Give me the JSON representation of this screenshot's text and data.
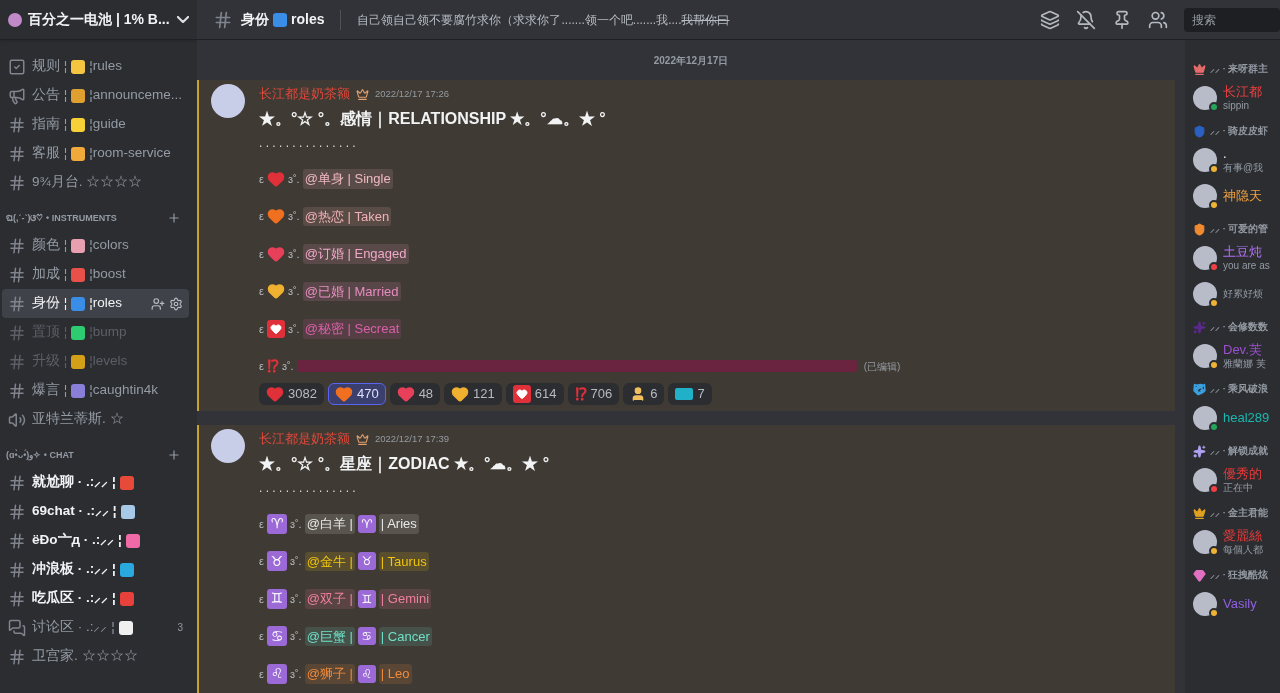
{
  "server": {
    "name": "百分之一电池 | 1% B..."
  },
  "sidebar": {
    "items": [
      {
        "kind": "rules",
        "name": "规则 ¦",
        "color": "#f5c542",
        "slug": "¦rules",
        "muted": false,
        "unread": false,
        "selected": false
      },
      {
        "kind": "announcement",
        "name": "公告 ¦",
        "color": "#e0a030",
        "slug": "¦announceme...",
        "muted": false,
        "unread": false,
        "selected": false
      },
      {
        "kind": "text",
        "name": "指南 ¦",
        "color": "#f7d038",
        "slug": "¦guide",
        "muted": false,
        "unread": false,
        "selected": false
      },
      {
        "kind": "text",
        "name": "客服 ¦",
        "color": "#f0a93a",
        "slug": "¦room-service",
        "muted": false,
        "unread": false,
        "selected": false
      },
      {
        "kind": "text",
        "name": "9¾月台. ☆☆☆☆",
        "muted": false,
        "unread": false,
        "selected": false
      },
      {
        "kind": "category",
        "name": "ଘ(,ˊ-ˋ)ଓ♡ • INSTRUMENTS"
      },
      {
        "kind": "text",
        "name": "颜色 ¦",
        "color": "#e8a0b0",
        "slug": "¦colors",
        "muted": false,
        "unread": false,
        "selected": false
      },
      {
        "kind": "text",
        "name": "加成 ¦",
        "color": "#e8504a",
        "slug": "¦boost",
        "muted": false,
        "unread": false,
        "selected": false
      },
      {
        "kind": "text",
        "name": "身份 ¦",
        "color": "#3a8ee8",
        "slug": "¦roles",
        "muted": false,
        "unread": false,
        "selected": true
      },
      {
        "kind": "text",
        "name": "置顶 ¦",
        "color": "#2ecc71",
        "slug": "¦bump",
        "muted": true,
        "unread": false,
        "selected": false
      },
      {
        "kind": "text",
        "name": "升级 ¦",
        "color": "#d4a017",
        "slug": "¦levels",
        "muted": true,
        "unread": false,
        "selected": false
      },
      {
        "kind": "text",
        "name": "爆言 ¦",
        "color": "#8a7fd8",
        "slug": "¦caughtin4k",
        "muted": false,
        "unread": false,
        "selected": false
      },
      {
        "kind": "voice",
        "name": "亚特兰蒂斯. ☆",
        "muted": false,
        "unread": false,
        "selected": false
      },
      {
        "kind": "category",
        "name": "(ɑ•̀ᴗ•́)و✧ • CHAT"
      },
      {
        "kind": "text",
        "name": "就尬聊 · .:⸝⸝ ¦",
        "color": "#e84a3a",
        "muted": false,
        "unread": true,
        "selected": false
      },
      {
        "kind": "text",
        "name": "69chat · .:⸝⸝ ¦",
        "color": "#a8c8e8",
        "muted": false,
        "unread": true,
        "selected": false
      },
      {
        "kind": "text",
        "name": "ëĐo亠д · .:⸝⸝ ¦",
        "color": "#f06aa8",
        "muted": false,
        "unread": true,
        "selected": false
      },
      {
        "kind": "text",
        "name": "冲浪板 · .:⸝⸝ ¦",
        "color": "#2aa8e0",
        "muted": false,
        "unread": true,
        "selected": false
      },
      {
        "kind": "text",
        "name": "吃瓜区 · .:⸝⸝ ¦",
        "color": "#e8403a",
        "muted": false,
        "unread": true,
        "selected": false
      },
      {
        "kind": "forum",
        "name": "讨论区 · .:⸝⸝ ¦",
        "color": "#f0f0f0",
        "muted": false,
        "unread": false,
        "selected": false,
        "badge": "3"
      },
      {
        "kind": "text",
        "name": "卫宫家. ☆☆☆☆",
        "muted": false,
        "unread": false,
        "selected": false
      }
    ]
  },
  "header": {
    "channel": "身份",
    "color": "#3a8ee8",
    "slug": "roles",
    "topic": "自己领自己领不要腐竹求你（求求你了.......领一个吧.......我....",
    "topic_struck": "我帮你曰",
    "search_placeholder": "搜索"
  },
  "divider": "2022年12月17日",
  "messages": [
    {
      "author": "长江都是奶茶额",
      "timestamp": "2022/12/17 17:26",
      "title": "★。°☆ °。感情｜RELATIONSHIP ★。°☁。★ °",
      "dots": ". . . . . . . . . . . . . . .",
      "lines": [
        {
          "kind": "relationship",
          "prefix": "ε",
          "emoji": {
            "kind": "heart",
            "color": "#e0303a"
          },
          "suffix": "ɜ˚.",
          "mention": "@单身 | Single",
          "color": "#f0b8c0"
        },
        {
          "kind": "relationship",
          "prefix": "ε",
          "emoji": {
            "kind": "heart",
            "color": "#f07020"
          },
          "suffix": "ɜ˚.",
          "mention": "@热恋 | Taken",
          "color": "#f0b0b8"
        },
        {
          "kind": "relationship",
          "prefix": "ε",
          "emoji": {
            "kind": "heart",
            "color": "#e8405a"
          },
          "suffix": "ɜ˚.",
          "mention": "@订婚 | Engaged",
          "color": "#f0a8c8"
        },
        {
          "kind": "relationship",
          "prefix": "ε",
          "emoji": {
            "kind": "heart",
            "color": "#f0b030"
          },
          "suffix": "ɜ˚.",
          "mention": "@已婚 | Married",
          "color": "#e88cc0"
        },
        {
          "kind": "relationship",
          "prefix": "ε",
          "emoji": {
            "kind": "box",
            "color": "#e0303a"
          },
          "suffix": "ɜ˚.",
          "mention": "@秘密 | Secreat",
          "color": "#d860a8"
        },
        {
          "kind": "redacted",
          "prefix": "ε",
          "emoji": {
            "kind": "glyph",
            "glyph": "⁉",
            "color": "#e0303a"
          },
          "suffix": "ɜ˚.",
          "color": "#6a2440",
          "edited": "(已编辑)"
        }
      ],
      "reactions": [
        {
          "emoji": {
            "kind": "heart",
            "color": "#e0303a"
          },
          "count": "3082",
          "selected": false
        },
        {
          "emoji": {
            "kind": "heart",
            "color": "#f07020"
          },
          "count": "470",
          "selected": true
        },
        {
          "emoji": {
            "kind": "heart",
            "color": "#e8405a"
          },
          "count": "48",
          "selected": false
        },
        {
          "emoji": {
            "kind": "heart",
            "color": "#f0b030"
          },
          "count": "121",
          "selected": false
        },
        {
          "emoji": {
            "kind": "box",
            "color": "#e0303a"
          },
          "count": "614",
          "selected": false
        },
        {
          "emoji": {
            "kind": "glyph",
            "glyph": "⁉",
            "color": "#e0303a"
          },
          "count": "706",
          "selected": false
        },
        {
          "emoji": {
            "kind": "person",
            "color": "#f0c060"
          },
          "count": "6",
          "selected": false
        },
        {
          "emoji": {
            "kind": "flag",
            "color": "#20b0c8"
          },
          "count": "7",
          "selected": false
        }
      ]
    },
    {
      "author": "长江都是奶茶额",
      "timestamp": "2022/12/17 17:39",
      "title": "★。°☆ °。星座｜ZODIAC ★。°☁。★ °",
      "dots": ". . . . . . . . . . . . . . .",
      "lines": [
        {
          "kind": "zodiac",
          "prefix": "ε",
          "sign": "♈",
          "suffix": "ɜ˚.",
          "mention_before": "@白羊 |",
          "inline_sign": "♈",
          "mention_after": "| Aries",
          "color": "#e8e8e8"
        },
        {
          "kind": "zodiac",
          "prefix": "ε",
          "sign": "♉",
          "suffix": "ɜ˚.",
          "mention_before": "@金牛 |",
          "inline_sign": "♉",
          "mention_after": "| Taurus",
          "color": "#f1c40f"
        },
        {
          "kind": "zodiac",
          "prefix": "ε",
          "sign": "♊",
          "suffix": "ɜ˚.",
          "mention_before": "@双子 |",
          "inline_sign": "♊",
          "mention_after": "| Gemini",
          "color": "#f07fa0"
        },
        {
          "kind": "zodiac",
          "prefix": "ε",
          "sign": "♋",
          "suffix": "ɜ˚.",
          "mention_before": "@巨蟹 |",
          "inline_sign": "♋",
          "mention_after": "| Cancer",
          "color": "#70e0c8"
        },
        {
          "kind": "zodiac",
          "prefix": "ε",
          "sign": "♌",
          "suffix": "ɜ˚.",
          "mention_before": "@狮子 |",
          "inline_sign": "♌",
          "mention_after": "| Leo",
          "color": "#f08a3c"
        }
      ]
    }
  ],
  "members": [
    {
      "kind": "crown",
      "color": "#e06c6c",
      "title": "⸝⸝ · 来呀群主",
      "members": [
        {
          "name": "长江都",
          "color": "#f04040",
          "status": "sippin",
          "kind": "online"
        }
      ]
    },
    {
      "kind": "shield",
      "color": "#2a60c0",
      "title": "⸝⸝ · 骑皮皮虾",
      "members": [
        {
          "name": ".",
          "status": "有事@我",
          "kind": "idle"
        },
        {
          "name": "神隐天",
          "color": "#f0a040",
          "kind": "idle"
        }
      ]
    },
    {
      "kind": "shield",
      "color": "#f08a30",
      "title": "⸝⸝ · 可爱的管",
      "members": [
        {
          "name": "土豆炖",
          "color": "#b070f0",
          "status": "you are as",
          "kind": "dnd"
        },
        {
          "status": "好累好烦",
          "kind": "idle"
        }
      ]
    },
    {
      "kind": "sparkles",
      "color": "#5a2a8a",
      "title": "⸝⸝ · 会修数数",
      "members": [
        {
          "name": "Dev.芙",
          "color": "#9b50d0",
          "status": "雅蘭娜 芙",
          "kind": "idle"
        }
      ]
    },
    {
      "kind": "handshake",
      "color": "#3aa0e0",
      "title": "⸝⸝ · 乘风破浪",
      "members": [
        {
          "name": "heal289",
          "color": "#1ab8b0",
          "kind": "online"
        }
      ]
    },
    {
      "kind": "sparkles",
      "color": "#b0a0f0",
      "title": "⸝⸝ · 解锁成就",
      "members": [
        {
          "name": "優秀的",
          "color": "#e83a3a",
          "status": "正在中",
          "kind": "dnd"
        }
      ]
    },
    {
      "kind": "crown",
      "color": "#e0a020",
      "title": "⸝⸝ · 金主君能",
      "members": [
        {
          "name": "愛麗絲",
          "color": "#e83a3a",
          "status": "每個人都",
          "kind": "idle"
        }
      ]
    },
    {
      "kind": "gem",
      "color": "#e070c0",
      "title": "⸝⸝ · 狂拽酷炫",
      "members": [
        {
          "name": "Vasily",
          "color": "#9060e0",
          "kind": "idle"
        }
      ]
    }
  ]
}
